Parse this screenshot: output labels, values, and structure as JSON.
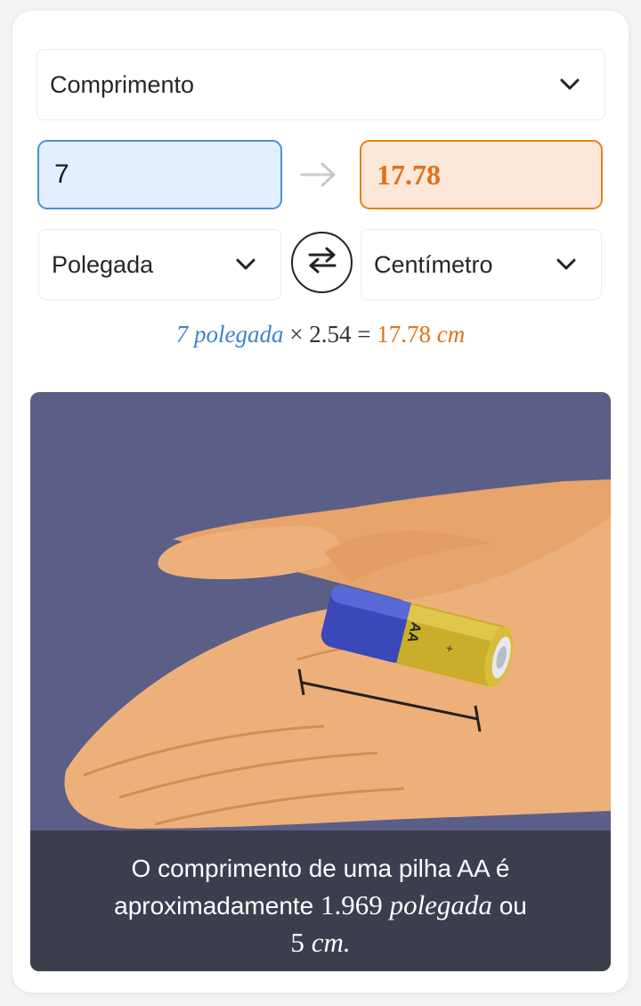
{
  "converter": {
    "quantity": "Comprimento",
    "from_value": "7",
    "to_value": "17.78",
    "from_unit": "Polegada",
    "to_unit": "Centímetro"
  },
  "formula": {
    "input": "7",
    "input_unit": "polegada",
    "times": "×",
    "factor": "2.54",
    "equals": "=",
    "result": "17.78",
    "result_unit": "cm"
  },
  "illustration": {
    "battery_label": "AA",
    "battery_plus": "+",
    "caption_line1": "O comprimento de uma pilha AA é",
    "caption_pre": "aproximadamente",
    "caption_value_in": "1.969",
    "caption_unit_in": "polegada",
    "caption_or": "ou",
    "caption_value_cm": "5",
    "caption_unit_cm": "cm."
  },
  "icons": {
    "dropdown": "chevron-down-icon",
    "arrow": "arrow-right-icon",
    "swap": "swap-icon"
  },
  "colors": {
    "input_border": "#4d8fd6",
    "input_bg": "#e3efff",
    "output_border": "#e8801e",
    "output_bg": "#fde7d8",
    "output_text": "#e2711a",
    "formula_blue": "#3e82cf",
    "illustration_bg": "#5b5f88",
    "caption_bg": "#3d3e4d"
  }
}
